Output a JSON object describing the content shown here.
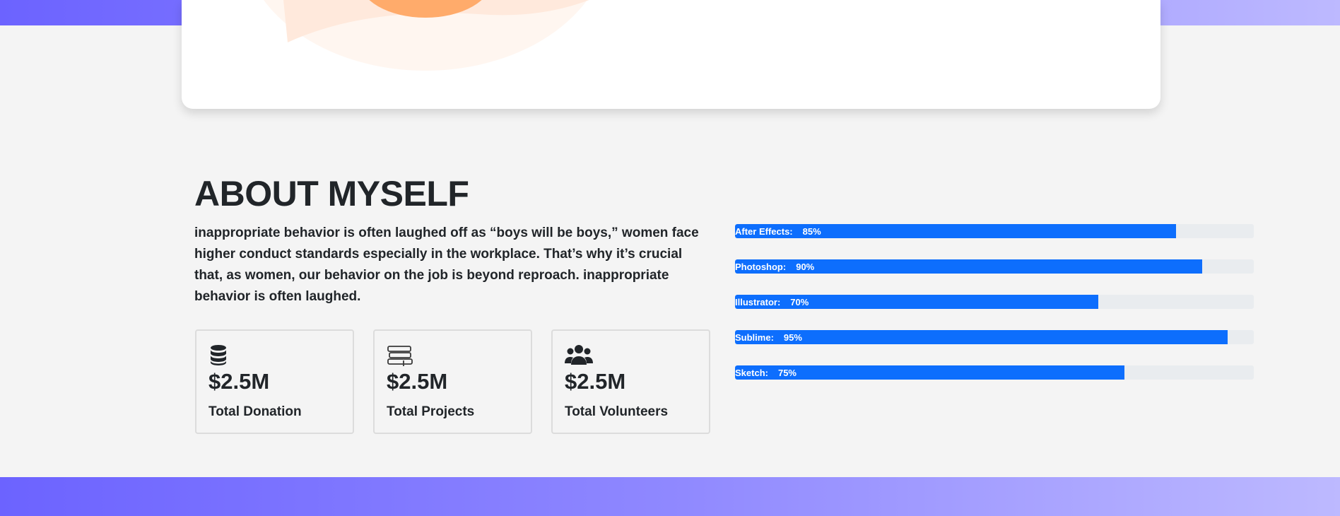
{
  "about": {
    "title": "ABOUT MYSELF",
    "description": "inappropriate behavior is often laughed off as “boys will be boys,” women face higher conduct standards especially in the workplace. That’s why it’s crucial that, as women, our behavior on the job is beyond reproach. inappropriate behavior is often laughed."
  },
  "stats": [
    {
      "icon": "database-icon",
      "value": "$2.5M",
      "label": "Total Donation"
    },
    {
      "icon": "books-icon",
      "value": "$2.5M",
      "label": "Total Projects"
    },
    {
      "icon": "users-icon",
      "value": "$2.5M",
      "label": "Total Volunteers"
    }
  ],
  "skills": [
    {
      "name": "After Effects:",
      "percent_label": "85%",
      "percent": 85
    },
    {
      "name": "Photoshop:",
      "percent_label": "90%",
      "percent": 90
    },
    {
      "name": "Illustrator:",
      "percent_label": "70%",
      "percent": 70
    },
    {
      "name": "Sublime:",
      "percent_label": "95%",
      "percent": 95
    },
    {
      "name": "Sketch:",
      "percent_label": "75%",
      "percent": 75
    }
  ],
  "colors": {
    "band_gradient_start": "#6c63ff",
    "band_gradient_end": "#bdb9ff",
    "progress_fill": "#0d6efd",
    "progress_track": "#e9ecef",
    "hero_accent": "#ffab6b"
  }
}
